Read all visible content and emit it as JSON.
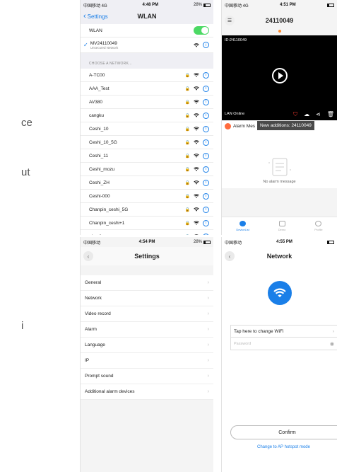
{
  "side_fragments": [
    "ce",
    "ut",
    "i"
  ],
  "wlan": {
    "status": {
      "carrier": "中国移动 4G",
      "time": "4:48 PM",
      "battery": "28%"
    },
    "back_label": "Settings",
    "title": "WLAN",
    "wlan_label": "WLAN",
    "connected": {
      "name": "MV24110049",
      "subtitle": "Unsecured Network"
    },
    "section_header": "CHOOSE A NETWORK...",
    "networks": [
      "A-TC00",
      "AAA_Test",
      "AV380",
      "cangku",
      "Ceshi_10",
      "Ceshi_10_5G",
      "Ceshi_11",
      "Ceshi_mozu",
      "Ceshi_ZH",
      "Ceshi-000",
      "Chanpin_ceshi_5G",
      "Chanpin_ceshi+1",
      "ebeeli"
    ]
  },
  "device": {
    "status": {
      "carrier": "中国移动 4G",
      "time": "4:51 PM"
    },
    "title": "24110049",
    "video_id": "ID:24110049",
    "lan_status": "LAN Online",
    "alarm_label": "Alarm Mes",
    "tooltip": "New additions: 24110049",
    "empty_text": "No alarm message",
    "tabs": [
      "DeviceList",
      "Demo",
      "Profile"
    ],
    "accent": "#1a7fe8"
  },
  "settings": {
    "status": {
      "carrier": "中国移动",
      "time": "4:54 PM",
      "battery": "28%"
    },
    "title": "Settings",
    "items": [
      "General",
      "Network",
      "Video record",
      "Alarm",
      "Language",
      "IP",
      "Prompt sound",
      "Additional alarm devices"
    ]
  },
  "network": {
    "status": {
      "carrier": "中国移动",
      "time": "4:55 PM"
    },
    "title": "Network",
    "wifi_field": "Tap here to change WiFi",
    "password_placeholder": "Password",
    "confirm_label": "Confirm",
    "ap_link": "Change to AP hotspot mode"
  }
}
